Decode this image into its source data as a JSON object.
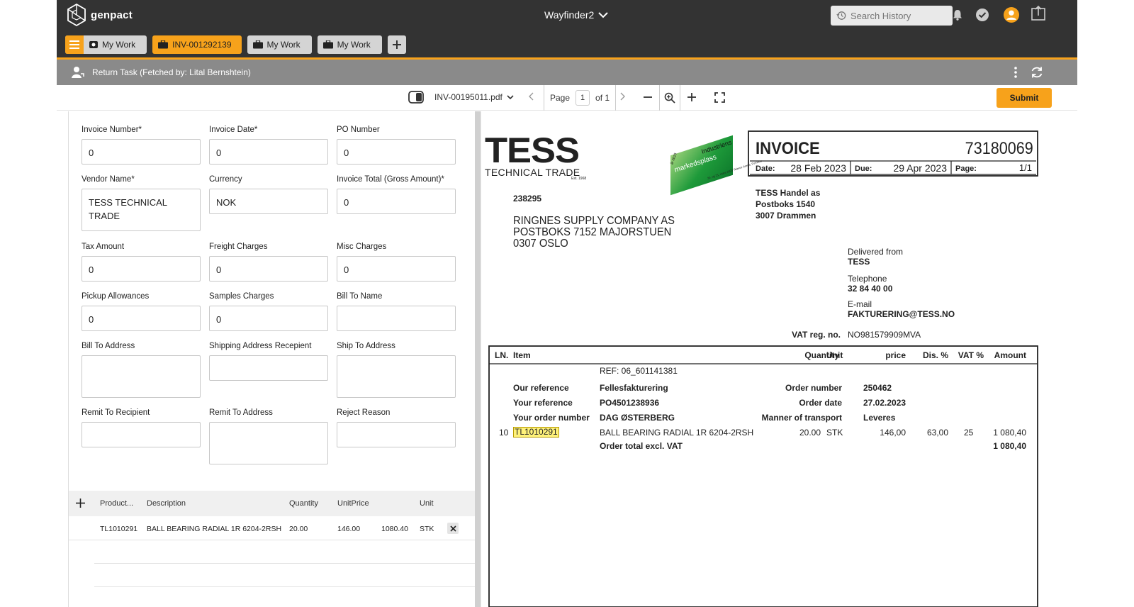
{
  "header": {
    "brand": "genpact",
    "app_title": "Wayfinder2",
    "search_placeholder": "Search History"
  },
  "tabs": [
    {
      "label": "My Work"
    },
    {
      "label": "INV-001292139"
    },
    {
      "label": "My Work"
    },
    {
      "label": "My Work"
    }
  ],
  "task_bar": {
    "label": "Return Task (Fetched by: Lital Bernshtein)"
  },
  "viewer_toolbar": {
    "file_name": "INV-00195011.pdf",
    "page_label": "Page",
    "page_value": "1",
    "page_of": "of 1",
    "submit_label": "Submit"
  },
  "form": {
    "fields": [
      {
        "label": "Invoice Number*",
        "value": "0"
      },
      {
        "label": "Invoice Date*",
        "value": "0"
      },
      {
        "label": "PO Number",
        "value": "0"
      },
      {
        "label": "Vendor Name*",
        "value": "TESS TECHNICAL TRADE"
      },
      {
        "label": "Currency",
        "value": "NOK"
      },
      {
        "label": "Invoice Total (Gross Amount)*",
        "value": "0"
      },
      {
        "label": "Tax Amount",
        "value": "0"
      },
      {
        "label": "Freight Charges",
        "value": "0"
      },
      {
        "label": "Misc Charges",
        "value": "0"
      },
      {
        "label": "Pickup Allowances",
        "value": "0"
      },
      {
        "label": "Samples Charges",
        "value": "0"
      },
      {
        "label": "Bill To Name",
        "value": ""
      },
      {
        "label": "Bill To Address",
        "value": ""
      },
      {
        "label": "Shipping Address Recepient",
        "value": ""
      },
      {
        "label": "Ship To Address",
        "value": ""
      },
      {
        "label": "Remit To Recipient",
        "value": ""
      },
      {
        "label": "Remit To Address",
        "value": ""
      },
      {
        "label": "Reject Reason",
        "value": ""
      }
    ]
  },
  "line_items": {
    "columns": [
      "Product...",
      "Description",
      "Quantity",
      "UnitPrice",
      "Unit"
    ],
    "rows": [
      {
        "product": "TL1010291",
        "description": "BALL BEARING RADIAL 1R 6204-2RSH",
        "quantity": "20.00",
        "unit_price": "146.00",
        "amount": "1080.40",
        "unit": "STK"
      }
    ]
  },
  "invoice_doc": {
    "logo_text": "TESS",
    "logo_sub": "TECHNICAL TRADE",
    "logo_tiny": "Est. 1968",
    "badge_line1": "Industriens",
    "badge_line2": "markedsplass",
    "badge_year": "år 2023",
    "badge_fine": "20. og 21. mars 2023 Telenor Arena, Fornebu",
    "customer_no": "238295",
    "recipient": [
      "RINGNES SUPPLY COMPANY AS",
      "POSTBOKS 7152 MAJORSTUEN",
      "0307 OSLO"
    ],
    "title": "INVOICE",
    "number": "73180069",
    "date_label": "Date:",
    "date": "28 Feb 2023",
    "due_label": "Due:",
    "due": "29 Apr 2023",
    "page_label": "Page:",
    "page": "1/1",
    "sender": [
      "TESS Handel as",
      "Postboks 1540",
      "3007 Drammen"
    ],
    "delivered_label": "Delivered from",
    "delivered": "TESS",
    "phone_label": "Telephone",
    "phone": "32 84 40 00",
    "email_label": "E-mail",
    "email": "FAKTURERING@TESS.NO",
    "vat_label": "VAT reg. no.",
    "vat": "NO981579909MVA",
    "table_headers": [
      "LN.",
      "Item",
      "Quantity",
      "Unit",
      "price",
      "Dis. %",
      "VAT %",
      "Amount"
    ],
    "ref_line": "REF: 06_601141381",
    "our_ref_label": "Our reference",
    "our_ref": "Fellesfakturering",
    "your_ref_label": "Your reference",
    "your_ref": "PO4501238936",
    "your_order_label": "Your order number",
    "your_order": "DAG ØSTERBERG",
    "order_number_label": "Order number",
    "order_number": "250462",
    "order_date_label": "Order date",
    "order_date": "27.02.2023",
    "transport_label": "Manner of transport",
    "transport": "Leveres",
    "line": {
      "ln": "10",
      "item": "TL1010291",
      "desc": "BALL BEARING RADIAL 1R 6204-2RSH",
      "qty": "20.00",
      "unit": "STK",
      "price": "146,00",
      "dis": "63,00",
      "vat": "25",
      "amount": "1 080,40"
    },
    "total_label": "Order total excl. VAT",
    "total": "1 080,40"
  },
  "colors": {
    "accent": "#f7a21b",
    "topbar": "#333333",
    "taskbar": "#8a8a8a",
    "badge_green": "#1e9a3a",
    "highlight": "#fff27a"
  }
}
